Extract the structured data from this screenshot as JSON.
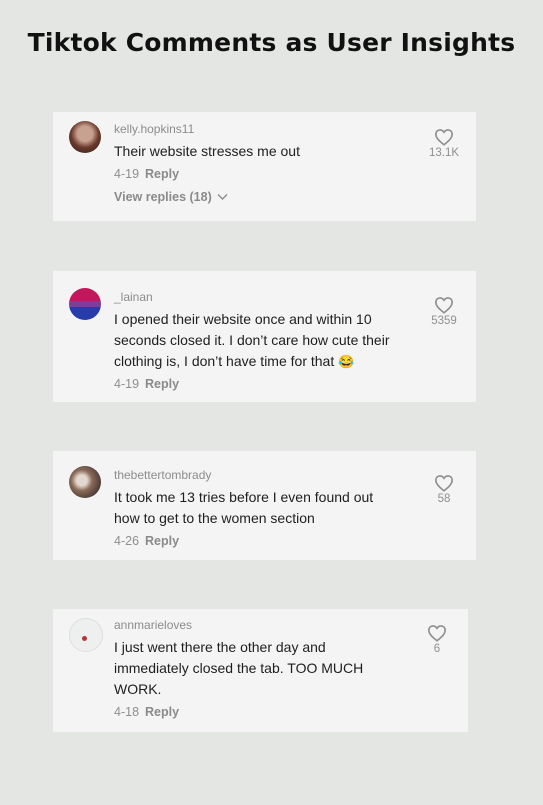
{
  "title": "Tiktok Comments as User Insights",
  "comments": [
    {
      "username": "kelly.hopkins11",
      "text": "Their website stresses me out",
      "date": "4-19",
      "reply": "Reply",
      "view_replies": "View replies (18)",
      "likes": "13.1K"
    },
    {
      "username": "_lainan",
      "text": "I opened their website once and within 10 seconds closed it. I don’t care how cute their clothing is, I don’t have time for that",
      "emoji": "😂",
      "date": "4-19",
      "reply": "Reply",
      "likes": "5359"
    },
    {
      "username": "thebettertombrady",
      "text": "It took me 13 tries before I even found out how to get to the women section",
      "date": "4-26",
      "reply": "Reply",
      "likes": "58"
    },
    {
      "username": "annmarieloves",
      "text": "I just went there the other day and immediately closed the tab. TOO MUCH WORK.",
      "date": "4-18",
      "reply": "Reply",
      "likes": "6"
    }
  ],
  "icons": {
    "like": "heart-outline-icon",
    "expand": "chevron-down-icon"
  }
}
